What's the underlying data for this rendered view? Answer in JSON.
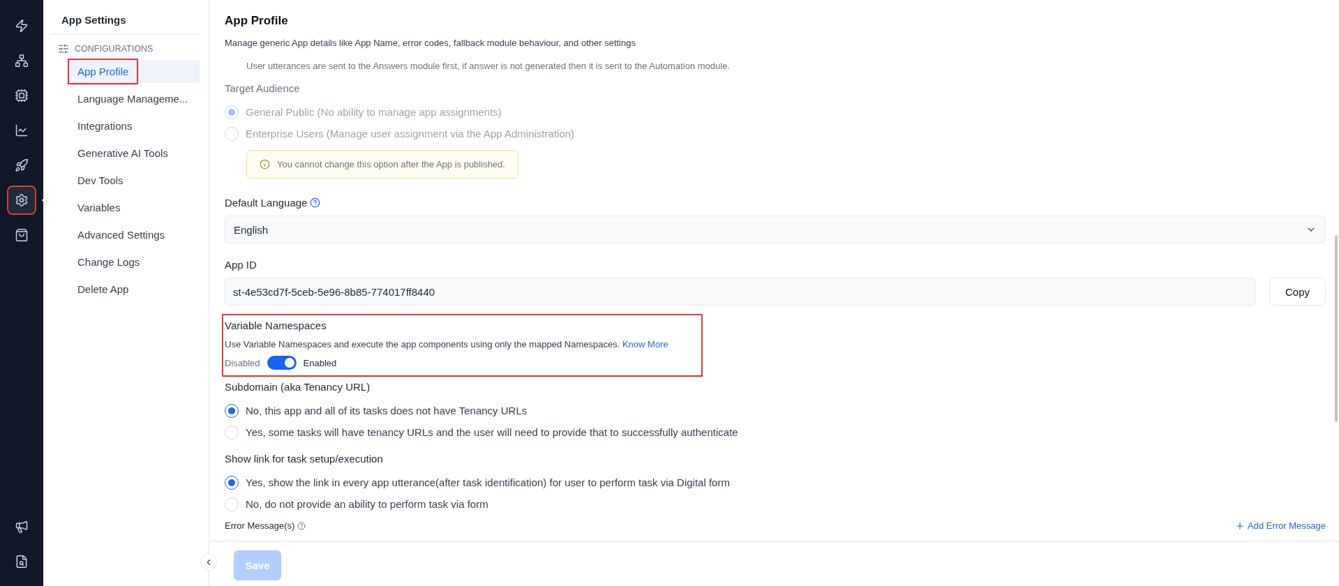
{
  "rail": {
    "items": [
      {
        "selected": false,
        "highlighted": false
      },
      {
        "selected": false,
        "highlighted": false
      },
      {
        "selected": false,
        "highlighted": false
      },
      {
        "selected": false,
        "highlighted": false
      },
      {
        "selected": false,
        "highlighted": false
      },
      {
        "selected": true,
        "highlighted": true
      },
      {
        "selected": false,
        "highlighted": false
      }
    ],
    "bottom_items": [
      {
        "selected": false
      },
      {
        "selected": false
      }
    ]
  },
  "sidebar": {
    "title": "App Settings",
    "section": "CONFIGURATIONS",
    "items": [
      {
        "label": "App Profile",
        "selected": true,
        "highlighted": true
      },
      {
        "label": "Language Manageme...",
        "selected": false,
        "highlighted": false
      },
      {
        "label": "Integrations",
        "selected": false,
        "highlighted": false
      },
      {
        "label": "Generative AI Tools",
        "selected": false,
        "highlighted": false
      },
      {
        "label": "Dev Tools",
        "selected": false,
        "highlighted": false
      },
      {
        "label": "Variables",
        "selected": false,
        "highlighted": false
      },
      {
        "label": "Advanced Settings",
        "selected": false,
        "highlighted": false
      },
      {
        "label": "Change Logs",
        "selected": false,
        "highlighted": false
      },
      {
        "label": "Delete App",
        "selected": false,
        "highlighted": false
      }
    ]
  },
  "page": {
    "title": "App Profile",
    "description": "Manage generic App details like App Name, error codes, fallback module behaviour, and other settings"
  },
  "routing_note": "User utterances are sent to the Answers module first, if answer is not generated then it is sent to the Automation module.",
  "target_audience": {
    "label": "Target Audience",
    "disabled": true,
    "options": [
      {
        "label": "General Public (No ability to manage app assignments)",
        "selected": true
      },
      {
        "label": "Enterprise Users (Manage user assignment via the App Administration)",
        "selected": false
      }
    ],
    "notice": "You cannot change this option after the App is published."
  },
  "default_language": {
    "label": "Default Language",
    "value": "English"
  },
  "app_id": {
    "label": "App ID",
    "value": "st-4e53cd7f-5ceb-5e96-8b85-774017ff8440",
    "button": "Copy"
  },
  "variable_namespaces": {
    "title": "Variable Namespaces",
    "description": "Use Variable Namespaces and execute the app components using only the mapped Namespaces.",
    "link": "Know More",
    "off_label": "Disabled",
    "on_label": "Enabled",
    "on": true,
    "highlighted": true
  },
  "subdomain": {
    "label": "Subdomain (aka Tenancy URL)",
    "options": [
      {
        "label": "No, this app and all of its tasks does not have Tenancy URLs",
        "selected": true
      },
      {
        "label": "Yes, some tasks will have tenancy URLs and the user will need to provide that to successfully authenticate",
        "selected": false
      }
    ]
  },
  "show_link": {
    "label": "Show link for task setup/execution",
    "options": [
      {
        "label": "Yes, show the link in every app utterance(after task identification) for user to perform task via Digital form",
        "selected": true
      },
      {
        "label": "No, do not provide an ability to perform task via form",
        "selected": false
      }
    ]
  },
  "error_messages": {
    "label": "Error Message(s)",
    "add_link": "Add Error Message"
  },
  "footer": {
    "save": "Save",
    "disabled": true
  }
}
